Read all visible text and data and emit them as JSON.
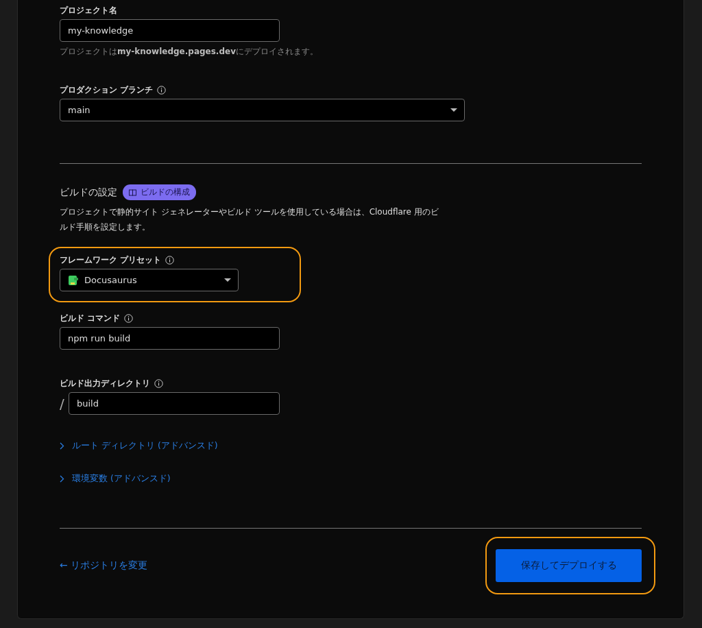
{
  "project_name": {
    "label": "プロジェクト名",
    "value": "my-knowledge",
    "hint": "プロジェクトは**my-knowledge.pages.dev**にデプロイされます。"
  },
  "production_branch": {
    "label": "プロダクション ブランチ",
    "value": "main"
  },
  "build_settings": {
    "title": "ビルドの設定",
    "badge": "ビルドの構成",
    "description": "プロジェクトで静的サイト ジェネレーターやビルド ツールを使用している場合は、Cloudflare 用のビルド手順を設定します。",
    "framework_preset": {
      "label": "フレームワーク プリセット",
      "value": "Docusaurus",
      "highlighted": true
    },
    "build_command": {
      "label": "ビルド コマンド",
      "value": "npm run build"
    },
    "output_directory": {
      "label": "ビルド出力ディレクトリ",
      "prefix": "/",
      "value": "build"
    },
    "advanced": [
      {
        "label": "ルート ディレクトリ (アドバンスド)",
        "expanded": false
      },
      {
        "label": "環境変数 (アドバンスド)",
        "expanded": false
      }
    ]
  },
  "footer": {
    "back_link": "← リポジトリを変更",
    "submit": {
      "label": "保存してデプロイする",
      "highlighted": true
    }
  }
}
